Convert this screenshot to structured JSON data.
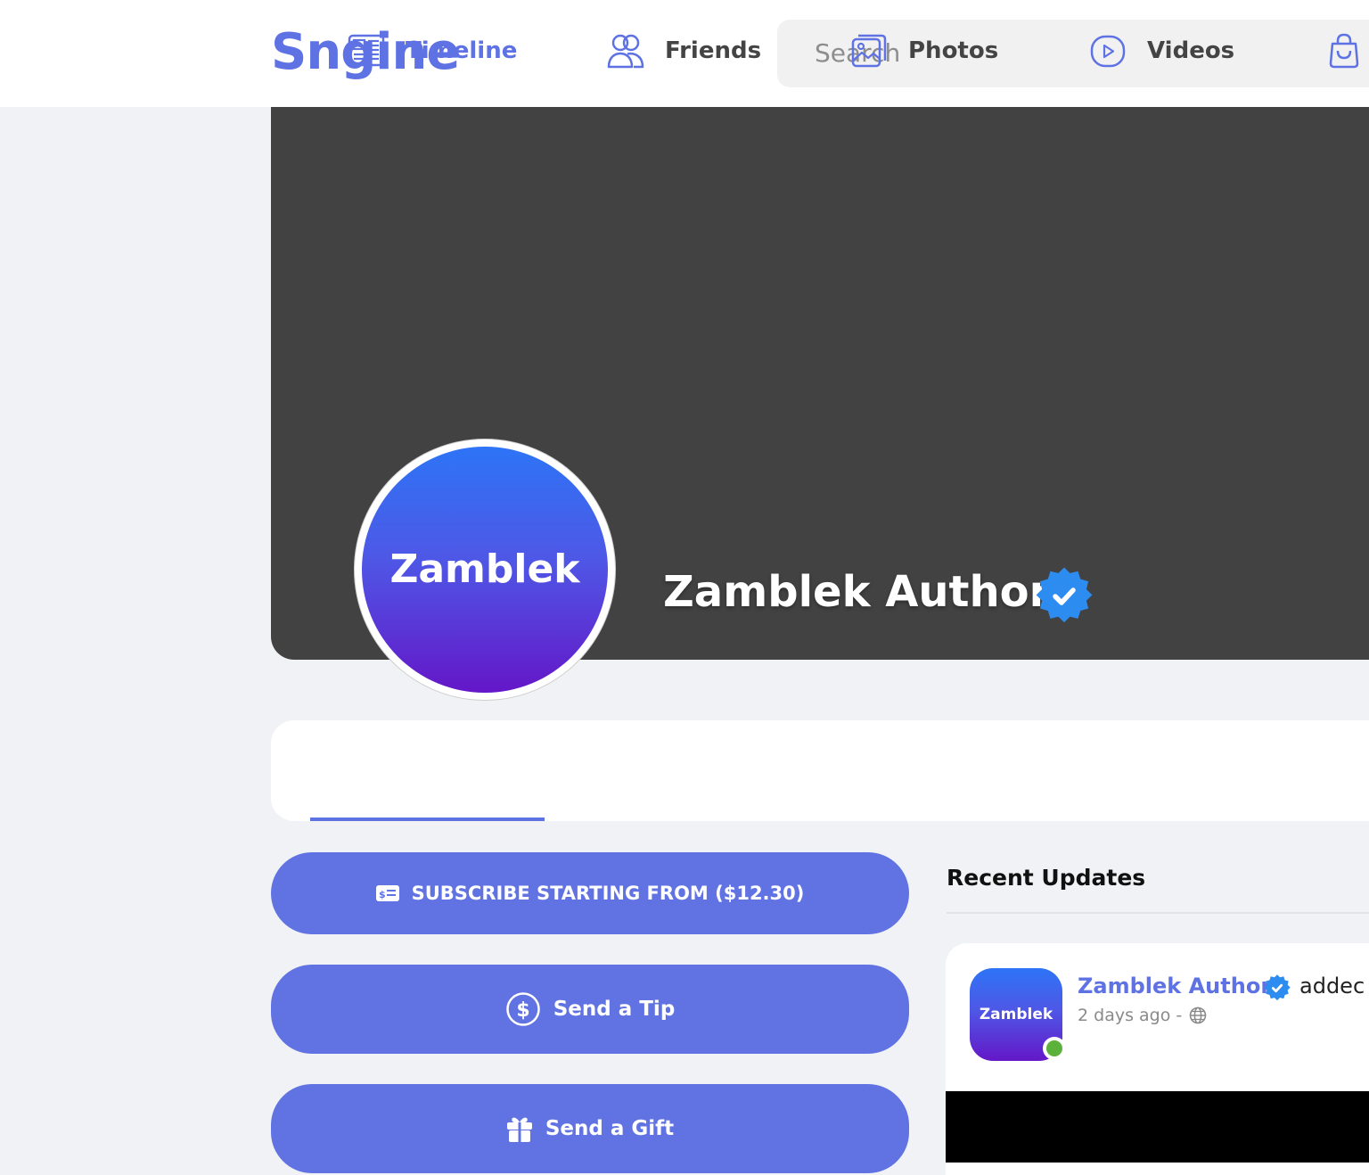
{
  "header": {
    "logo": "Sngine",
    "search_placeholder": "Search"
  },
  "profile": {
    "avatar_text": "Zamblek",
    "name": "Zamblek Author",
    "verified": true
  },
  "tabs": [
    {
      "label": "Timeline",
      "icon": "newspaper-icon",
      "active": true
    },
    {
      "label": "Friends",
      "icon": "users-icon",
      "active": false
    },
    {
      "label": "Photos",
      "icon": "photos-icon",
      "active": false
    },
    {
      "label": "Videos",
      "icon": "video-icon",
      "active": false
    },
    {
      "label": "",
      "icon": "shopping-bag-icon",
      "active": false
    }
  ],
  "actions": {
    "subscribe": "SUBSCRIBE STARTING FROM ($12.30)",
    "tip": "Send a Tip",
    "gift": "Send a Gift"
  },
  "recent": {
    "title": "Recent Updates",
    "post": {
      "avatar_text": "Zamblek",
      "author": "Zamblek Author",
      "action": "addec",
      "time": "2 days ago - ",
      "privacy_icon": "globe-icon"
    }
  },
  "colors": {
    "accent": "#5e72e4",
    "button": "#6173e2",
    "cover": "#424242",
    "verified": "#2d8cf0",
    "online": "#5cb13a"
  }
}
